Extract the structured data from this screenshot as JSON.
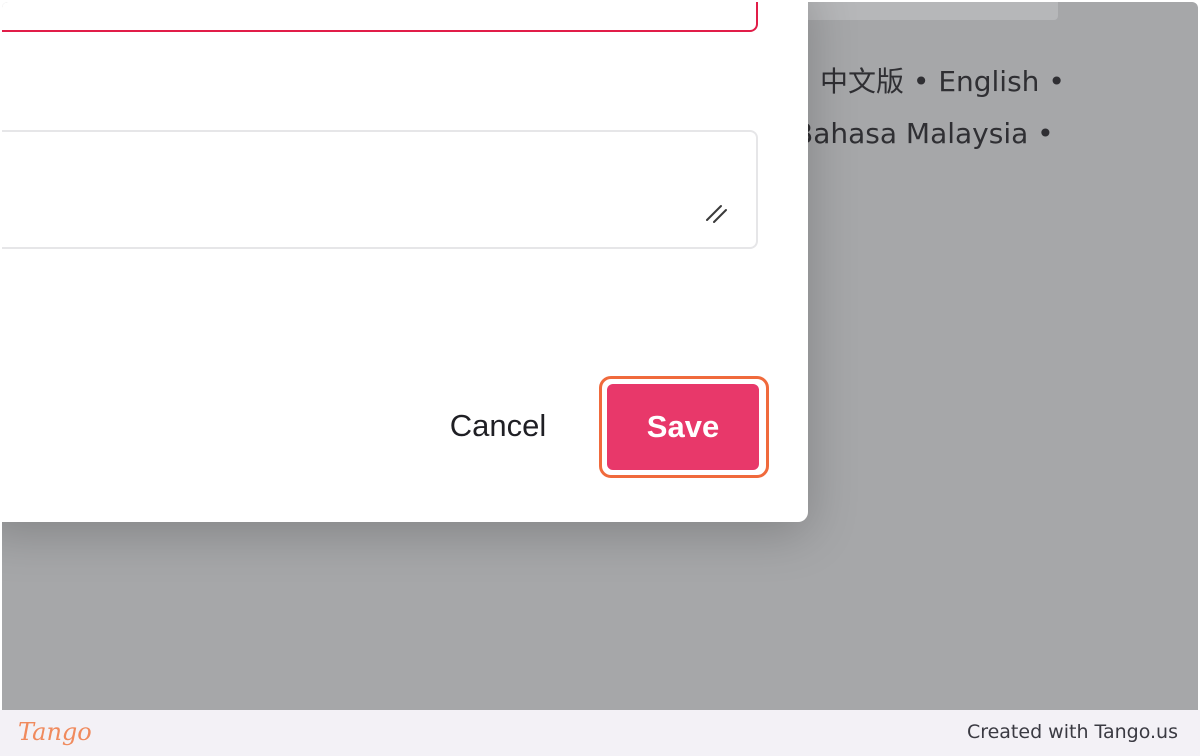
{
  "background": {
    "language_links_line1": "中文版 • English •",
    "language_links_line2": "Bahasa Malaysia •"
  },
  "dialog": {
    "cancel_label": "Cancel",
    "save_label": "Save"
  },
  "footer": {
    "logo_text": "Tango",
    "credit": "Created with Tango.us"
  },
  "colors": {
    "save_button": "#e8386a",
    "save_highlight": "#f06a3c",
    "field_error_border": "#e11d48",
    "overlay": "#a6a7a9"
  },
  "icons": {
    "resize_handle": "resize-handle-icon"
  }
}
